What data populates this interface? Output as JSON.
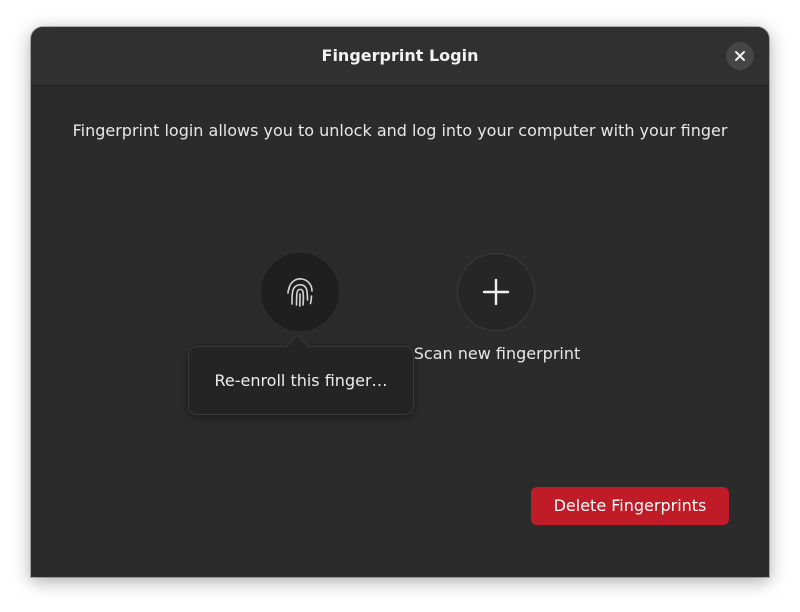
{
  "dialog": {
    "title": "Fingerprint Login",
    "close_icon": "close-icon",
    "description": "Fingerprint login allows you to unlock and log into your computer with your finger"
  },
  "fingers": {
    "enrolled": {
      "icon": "fingerprint-icon"
    },
    "scan_new": {
      "icon": "plus-icon",
      "label": "Scan new fingerprint"
    }
  },
  "popover": {
    "item_label": "Re-enroll this finger…"
  },
  "actions": {
    "delete_label": "Delete Fingerprints"
  },
  "colors": {
    "window_bg": "#2b2b2b",
    "titlebar_bg": "#303030",
    "destructive": "#c01c28",
    "text": "#e8e8e8"
  }
}
